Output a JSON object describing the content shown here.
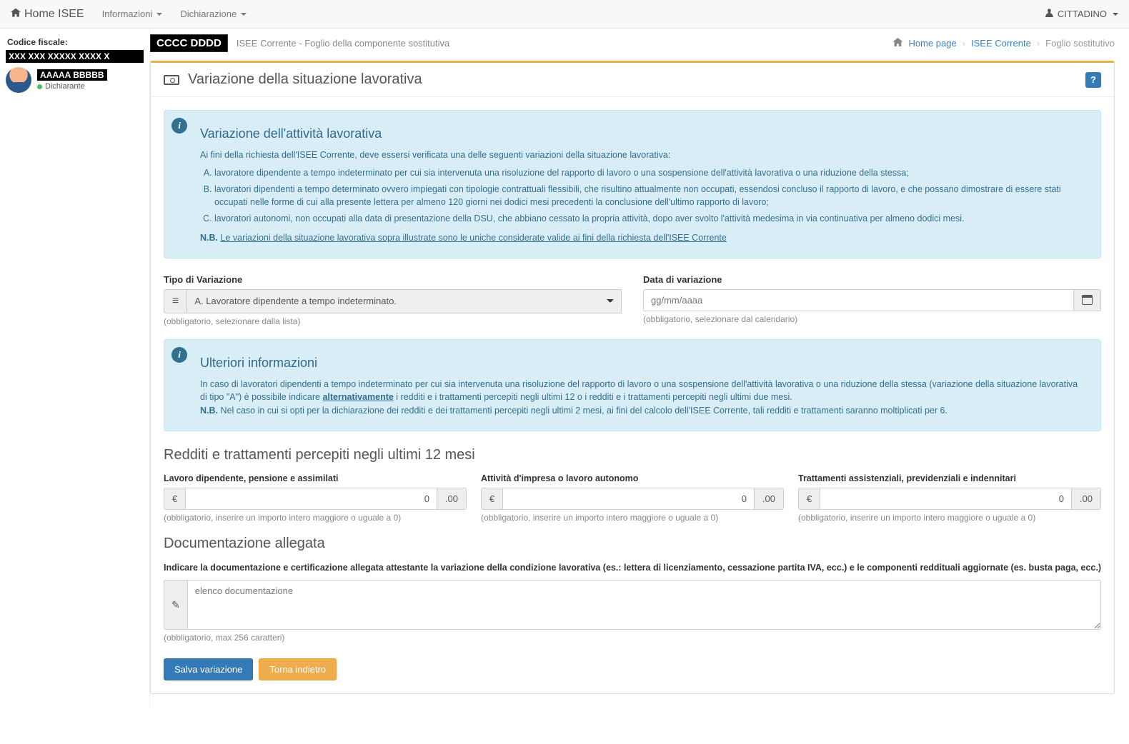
{
  "navbar": {
    "brand": "Home ISEE",
    "items": [
      "Informazioni",
      "Dichiarazione"
    ],
    "user": "CITTADINO"
  },
  "sidebar": {
    "cf_label": "Codice fiscale:",
    "cf_value": "XXX XXX XXXXX XXXX X",
    "name": "AAAAA BBBBB",
    "role": "Dichiarante"
  },
  "header": {
    "redacted": "CCCC DDDD",
    "subtitle": "ISEE Corrente - Foglio della componente sostitutiva"
  },
  "breadcrumb": {
    "home": "Home page",
    "mid": "ISEE Corrente",
    "current": "Foglio sostitutivo"
  },
  "panel": {
    "title": "Variazione della situazione lavorativa"
  },
  "info1": {
    "title": "Variazione dell'attività lavorativa",
    "intro": "Ai fini della richiesta dell'ISEE Corrente, deve essersi verificata una delle seguenti variazioni della situazione lavorativa:",
    "li_a": "lavoratore dipendente a tempo indeterminato per cui sia intervenuta una risoluzione del rapporto di lavoro o una sospensione dell'attività lavorativa o una riduzione della stessa;",
    "li_b": "lavoratori dipendenti a tempo determinato ovvero impiegati con tipologie contrattuali flessibili, che risultino attualmente non occupati, essendosi concluso il rapporto di lavoro, e che possano dimostrare di essere stati occupati nelle forme di cui alla presente lettera per almeno 120 giorni nei dodici mesi precedenti la conclusione dell'ultimo rapporto di lavoro;",
    "li_c": "lavoratori autonomi, non occupati alla data di presentazione della DSU, che abbiano cessato la propria attività, dopo aver svolto l'attività medesima in via continuativa per almeno dodici mesi.",
    "nb_label": "N.B.",
    "nb_text": "Le variazioni della situazione lavorativa sopra illustrate sono le uniche considerate valide ai fini della richiesta dell'ISEE Corrente"
  },
  "form": {
    "tipo_label": "Tipo di Variazione",
    "tipo_value": "A. Lavoratore dipendente a tempo indeterminato.",
    "tipo_helper": "(obbligatorio, selezionare dalla lista)",
    "data_label": "Data di variazione",
    "data_placeholder": "gg/mm/aaaa",
    "data_helper": "(obbligatorio, selezionare dal calendario)"
  },
  "info2": {
    "title": "Ulteriori informazioni",
    "text_a": "In caso di lavoratori dipendenti a tempo indeterminato per cui sia intervenuta una risoluzione del rapporto di lavoro o una sospensione dell'attività lavorativa o una riduzione della stessa (variazione della situazione lavorativa di tipo \"A\") è possibile indicare ",
    "text_b": "alternativamente",
    "text_c": " i redditi e i trattamenti percepiti negli ultimi 12 o i redditi e i trattamenti percepiti negli ultimi due mesi.",
    "nb_label": "N.B.",
    "nb_text": " Nel caso in cui si opti per la dichiarazione dei redditi e dei trattamenti percepiti negli ultimi 2 mesi, ai fini del calcolo dell'ISEE Corrente, tali redditi e trattamenti saranno moltiplicati per 6."
  },
  "redditi": {
    "title": "Redditi e trattamenti percepiti negli ultimi 12 mesi",
    "euro": "€",
    "decimal": ".00",
    "col1_label": "Lavoro dipendente, pensione e assimilati",
    "col1_value": "0",
    "col1_helper": "(obbligatorio, inserire un importo intero maggiore o uguale a 0)",
    "col2_label": "Attività d'impresa o lavoro autonomo",
    "col2_value": "0",
    "col2_helper": "(obbligatorio, inserire un importo intero maggiore o uguale a 0)",
    "col3_label": "Trattamenti assistenziali, previdenziali e indennitari",
    "col3_value": "0",
    "col3_helper": "(obbligatorio, inserire un importo intero maggiore o uguale a 0)"
  },
  "docs": {
    "title": "Documentazione allegata",
    "label": "Indicare la documentazione e certificazione allegata attestante la variazione della condizione lavorativa (es.: lettera di licenziamento, cessazione partita IVA, ecc.) e le componenti reddituali aggiornate (es. busta paga, ecc.)",
    "placeholder": "elenco documentazione",
    "helper": "(obbligatorio, max 256 caratteri)"
  },
  "buttons": {
    "save": "Salva variazione",
    "back": "Torna indietro"
  }
}
